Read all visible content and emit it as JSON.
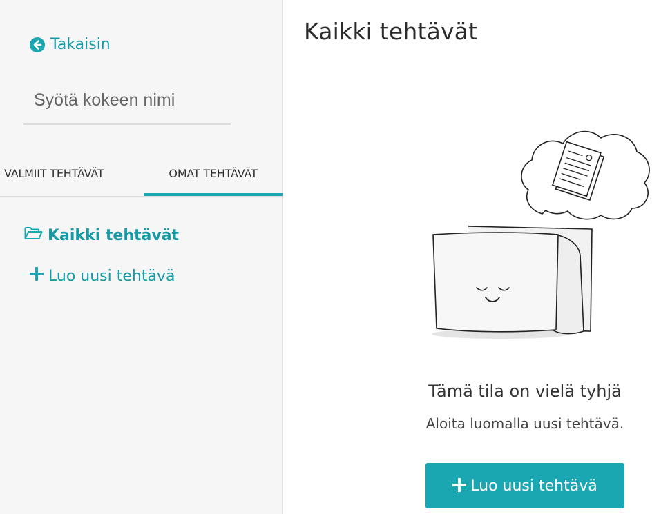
{
  "sidebar": {
    "back_label": "Takaisin",
    "exam_name_placeholder": "Syötä kokeen nimi",
    "tabs": [
      {
        "label": "VALMIIT TEHTÄVÄT"
      },
      {
        "label": "OMAT TEHTÄVÄT",
        "active": true
      }
    ],
    "nav": {
      "all_tasks_label": "Kaikki tehtävät",
      "new_task_label": "Luo uusi tehtävä"
    }
  },
  "main": {
    "title": "Kaikki tehtävät",
    "empty_state": {
      "title": "Tämä tila on vielä tyhjä",
      "text": "Aloita luomalla uusi tehtävä.",
      "button_label": "Luo uusi tehtävä"
    }
  },
  "colors": {
    "accent": "#1aa7b2",
    "sidebar_bg": "#f6f6f6"
  },
  "icons": [
    "arrow-circle-left-icon",
    "folder-open-icon",
    "plus-icon"
  ]
}
